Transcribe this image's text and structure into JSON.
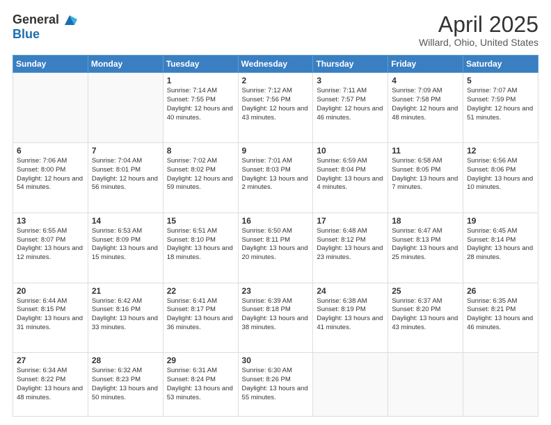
{
  "header": {
    "logo_general": "General",
    "logo_blue": "Blue",
    "title": "April 2025",
    "subtitle": "Willard, Ohio, United States"
  },
  "days_of_week": [
    "Sunday",
    "Monday",
    "Tuesday",
    "Wednesday",
    "Thursday",
    "Friday",
    "Saturday"
  ],
  "weeks": [
    [
      {
        "day": "",
        "info": ""
      },
      {
        "day": "",
        "info": ""
      },
      {
        "day": "1",
        "info": "Sunrise: 7:14 AM\nSunset: 7:55 PM\nDaylight: 12 hours and 40 minutes."
      },
      {
        "day": "2",
        "info": "Sunrise: 7:12 AM\nSunset: 7:56 PM\nDaylight: 12 hours and 43 minutes."
      },
      {
        "day": "3",
        "info": "Sunrise: 7:11 AM\nSunset: 7:57 PM\nDaylight: 12 hours and 46 minutes."
      },
      {
        "day": "4",
        "info": "Sunrise: 7:09 AM\nSunset: 7:58 PM\nDaylight: 12 hours and 48 minutes."
      },
      {
        "day": "5",
        "info": "Sunrise: 7:07 AM\nSunset: 7:59 PM\nDaylight: 12 hours and 51 minutes."
      }
    ],
    [
      {
        "day": "6",
        "info": "Sunrise: 7:06 AM\nSunset: 8:00 PM\nDaylight: 12 hours and 54 minutes."
      },
      {
        "day": "7",
        "info": "Sunrise: 7:04 AM\nSunset: 8:01 PM\nDaylight: 12 hours and 56 minutes."
      },
      {
        "day": "8",
        "info": "Sunrise: 7:02 AM\nSunset: 8:02 PM\nDaylight: 12 hours and 59 minutes."
      },
      {
        "day": "9",
        "info": "Sunrise: 7:01 AM\nSunset: 8:03 PM\nDaylight: 13 hours and 2 minutes."
      },
      {
        "day": "10",
        "info": "Sunrise: 6:59 AM\nSunset: 8:04 PM\nDaylight: 13 hours and 4 minutes."
      },
      {
        "day": "11",
        "info": "Sunrise: 6:58 AM\nSunset: 8:05 PM\nDaylight: 13 hours and 7 minutes."
      },
      {
        "day": "12",
        "info": "Sunrise: 6:56 AM\nSunset: 8:06 PM\nDaylight: 13 hours and 10 minutes."
      }
    ],
    [
      {
        "day": "13",
        "info": "Sunrise: 6:55 AM\nSunset: 8:07 PM\nDaylight: 13 hours and 12 minutes."
      },
      {
        "day": "14",
        "info": "Sunrise: 6:53 AM\nSunset: 8:09 PM\nDaylight: 13 hours and 15 minutes."
      },
      {
        "day": "15",
        "info": "Sunrise: 6:51 AM\nSunset: 8:10 PM\nDaylight: 13 hours and 18 minutes."
      },
      {
        "day": "16",
        "info": "Sunrise: 6:50 AM\nSunset: 8:11 PM\nDaylight: 13 hours and 20 minutes."
      },
      {
        "day": "17",
        "info": "Sunrise: 6:48 AM\nSunset: 8:12 PM\nDaylight: 13 hours and 23 minutes."
      },
      {
        "day": "18",
        "info": "Sunrise: 6:47 AM\nSunset: 8:13 PM\nDaylight: 13 hours and 25 minutes."
      },
      {
        "day": "19",
        "info": "Sunrise: 6:45 AM\nSunset: 8:14 PM\nDaylight: 13 hours and 28 minutes."
      }
    ],
    [
      {
        "day": "20",
        "info": "Sunrise: 6:44 AM\nSunset: 8:15 PM\nDaylight: 13 hours and 31 minutes."
      },
      {
        "day": "21",
        "info": "Sunrise: 6:42 AM\nSunset: 8:16 PM\nDaylight: 13 hours and 33 minutes."
      },
      {
        "day": "22",
        "info": "Sunrise: 6:41 AM\nSunset: 8:17 PM\nDaylight: 13 hours and 36 minutes."
      },
      {
        "day": "23",
        "info": "Sunrise: 6:39 AM\nSunset: 8:18 PM\nDaylight: 13 hours and 38 minutes."
      },
      {
        "day": "24",
        "info": "Sunrise: 6:38 AM\nSunset: 8:19 PM\nDaylight: 13 hours and 41 minutes."
      },
      {
        "day": "25",
        "info": "Sunrise: 6:37 AM\nSunset: 8:20 PM\nDaylight: 13 hours and 43 minutes."
      },
      {
        "day": "26",
        "info": "Sunrise: 6:35 AM\nSunset: 8:21 PM\nDaylight: 13 hours and 46 minutes."
      }
    ],
    [
      {
        "day": "27",
        "info": "Sunrise: 6:34 AM\nSunset: 8:22 PM\nDaylight: 13 hours and 48 minutes."
      },
      {
        "day": "28",
        "info": "Sunrise: 6:32 AM\nSunset: 8:23 PM\nDaylight: 13 hours and 50 minutes."
      },
      {
        "day": "29",
        "info": "Sunrise: 6:31 AM\nSunset: 8:24 PM\nDaylight: 13 hours and 53 minutes."
      },
      {
        "day": "30",
        "info": "Sunrise: 6:30 AM\nSunset: 8:26 PM\nDaylight: 13 hours and 55 minutes."
      },
      {
        "day": "",
        "info": ""
      },
      {
        "day": "",
        "info": ""
      },
      {
        "day": "",
        "info": ""
      }
    ]
  ]
}
